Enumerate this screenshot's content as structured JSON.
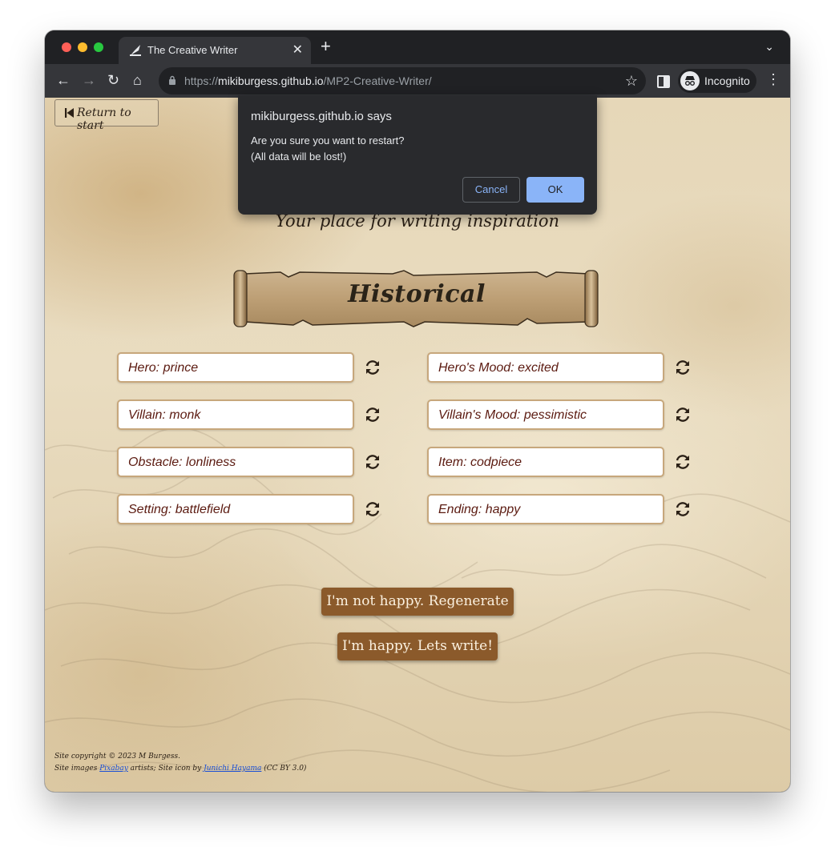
{
  "browser": {
    "tab_title": "The Creative Writer",
    "tab_close": "✕",
    "new_tab": "+",
    "tab_menu": "⌄",
    "url_scheme": "https://",
    "url_host": "mikiburgess.github.io",
    "url_path": "/MP2-Creative-Writer/",
    "profile_label": "Incognito",
    "back": "←",
    "forward": "→",
    "reload": "↻",
    "home": "⌂",
    "bookmark": "☆",
    "menu": "⋮"
  },
  "page": {
    "return_label": "Return to start",
    "tagline": "Your place for writing inspiration",
    "genre": "Historical",
    "fields": [
      {
        "label": "Hero: prince",
        "icon": "refresh-icon"
      },
      {
        "label": "Hero's Mood: excited",
        "icon": "refresh-icon"
      },
      {
        "label": "Villain: monk",
        "icon": "refresh-icon"
      },
      {
        "label": "Villain's Mood: pessimistic",
        "icon": "refresh-icon"
      },
      {
        "label": "Obstacle: lonliness",
        "icon": "refresh-icon"
      },
      {
        "label": "Item: codpiece",
        "icon": "refresh-icon"
      },
      {
        "label": "Setting: battlefield",
        "icon": "refresh-icon"
      },
      {
        "label": "Ending: happy",
        "icon": "refresh-icon"
      }
    ],
    "regenerate_label": "I'm not happy. Regenerate",
    "write_label": "I'm happy. Lets write!",
    "footer": {
      "copyright": "Site copyright © 2023 M Burgess.",
      "images_prefix": "Site images ",
      "pixabay": "Pixabay",
      "images_middle": " artists; Site icon by ",
      "icon_author": "Junichi Hayama",
      "license": " (CC BY 3.0)"
    }
  },
  "dialog": {
    "origin": "mikiburgess.github.io says",
    "message_line1": "Are you sure you want to restart?",
    "message_line2": "(All data will be lost!)",
    "cancel": "Cancel",
    "ok": "OK"
  },
  "colors": {
    "accent_button": "#8b5a2b",
    "field_text": "#5b1a10",
    "dialog_ok": "#8ab4f8"
  }
}
